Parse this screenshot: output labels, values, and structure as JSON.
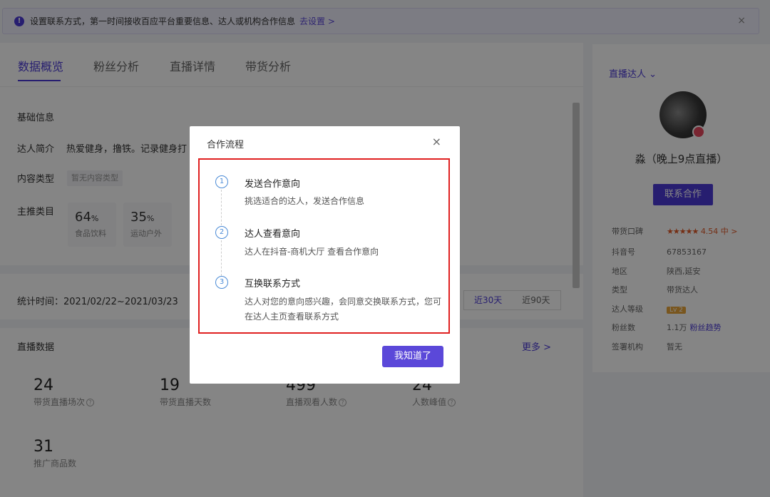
{
  "notice": {
    "text": "设置联系方式，第一时间接收百应平台重要信息、达人或机构合作信息",
    "link": "去设置 >",
    "close": "×"
  },
  "tabs": [
    "数据概览",
    "粉丝分析",
    "直播详情",
    "带货分析"
  ],
  "basic": {
    "title": "基础信息",
    "intro_label": "达人简介",
    "intro_value": "热爱健身，撸铁。记录健身打",
    "content_label": "内容类型",
    "content_value": "暂无内容类型",
    "category_label": "主推类目",
    "categories": [
      {
        "pct": "64",
        "unit": "%",
        "name": "食品饮料"
      },
      {
        "pct": "35",
        "unit": "%",
        "name": "运动户外"
      }
    ]
  },
  "stats": {
    "time_label": "统计时间：2021/02/22~2021/03/23",
    "ranges": [
      "近30天",
      "近90天"
    ]
  },
  "live": {
    "title": "直播数据",
    "more": "更多 >",
    "metrics": [
      {
        "num": "24",
        "label": "带货直播场次"
      },
      {
        "num": "19",
        "label": "带货直播天数"
      },
      {
        "num": "499",
        "label": "直播观看人数"
      },
      {
        "num": "24",
        "label": "人数峰值"
      },
      {
        "num": "31",
        "label": "推广商品数"
      }
    ]
  },
  "side": {
    "title": "直播达人",
    "name": "淼（晚上9点直播）",
    "contact_btn": "联系合作",
    "rows": {
      "rating_k": "带货口碑",
      "rating_stars": "★★★★★",
      "rating_v": "4.54 中 >",
      "douyin_k": "抖音号",
      "douyin_v": "67853167",
      "area_k": "地区",
      "area_v": "陕西,延安",
      "type_k": "类型",
      "type_v": "带货达人",
      "level_k": "达人等级",
      "level_v": "Lv 2",
      "fans_k": "粉丝数",
      "fans_v": "1.1万",
      "fans_link": "粉丝趋势",
      "org_k": "签署机构",
      "org_v": "暂无"
    }
  },
  "modal": {
    "title": "合作流程",
    "close": "×",
    "steps": [
      {
        "num": "1",
        "title": "发送合作意向",
        "desc": "挑选适合的达人，发送合作信息"
      },
      {
        "num": "2",
        "title": "达人查看意向",
        "desc": "达人在抖音-商机大厅 查看合作意向"
      },
      {
        "num": "3",
        "title": "互换联系方式",
        "desc": "达人对您的意向感兴趣，会同意交换联系方式，您可在达人主页查看联系方式"
      }
    ],
    "ok": "我知道了"
  }
}
